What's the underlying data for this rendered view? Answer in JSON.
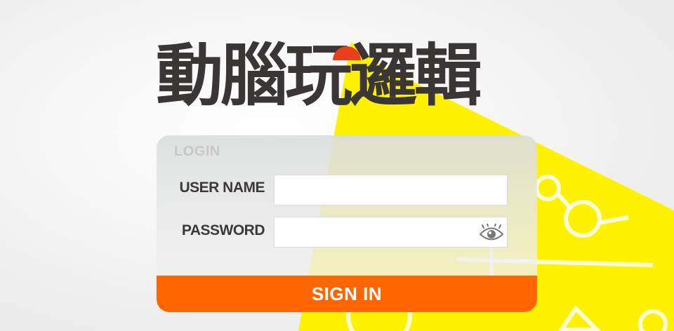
{
  "logo": {
    "text": "動腦玩邏輯"
  },
  "login": {
    "title": "LOGIN",
    "username_label": "USER NAME",
    "username_value": "",
    "password_label": "PASSWORD",
    "password_value": "",
    "show_password_icon": "eye-icon",
    "signin_label": "SIGN IN"
  },
  "colors": {
    "accent": "#ff6600",
    "spotlight": "#fff200",
    "text_dark": "#3a3636",
    "bulb_red": "#e8401c"
  }
}
